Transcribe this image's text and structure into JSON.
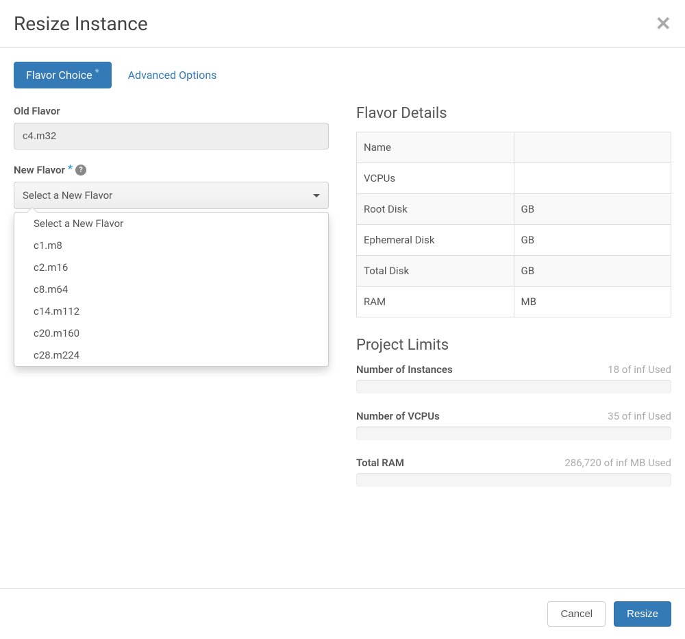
{
  "title": "Resize Instance",
  "tabs": {
    "flavor_choice": "Flavor Choice",
    "advanced_options": "Advanced Options"
  },
  "form": {
    "old_flavor_label": "Old Flavor",
    "old_flavor_value": "c4.m32",
    "new_flavor_label": "New Flavor",
    "new_flavor_placeholder": "Select a New Flavor",
    "new_flavor_options": [
      "Select a New Flavor",
      "c1.m8",
      "c2.m16",
      "c8.m64",
      "c14.m112",
      "c20.m160",
      "c28.m224"
    ]
  },
  "flavor_details": {
    "title": "Flavor Details",
    "rows": [
      {
        "label": "Name",
        "value": ""
      },
      {
        "label": "VCPUs",
        "value": ""
      },
      {
        "label": "Root Disk",
        "value": "GB"
      },
      {
        "label": "Ephemeral Disk",
        "value": "GB"
      },
      {
        "label": "Total Disk",
        "value": "GB"
      },
      {
        "label": "RAM",
        "value": "MB"
      }
    ]
  },
  "project_limits": {
    "title": "Project Limits",
    "items": [
      {
        "label": "Number of Instances",
        "value": "18 of inf Used"
      },
      {
        "label": "Number of VCPUs",
        "value": "35 of inf Used"
      },
      {
        "label": "Total RAM",
        "value": "286,720 of inf MB Used"
      }
    ]
  },
  "footer": {
    "cancel": "Cancel",
    "resize": "Resize"
  }
}
